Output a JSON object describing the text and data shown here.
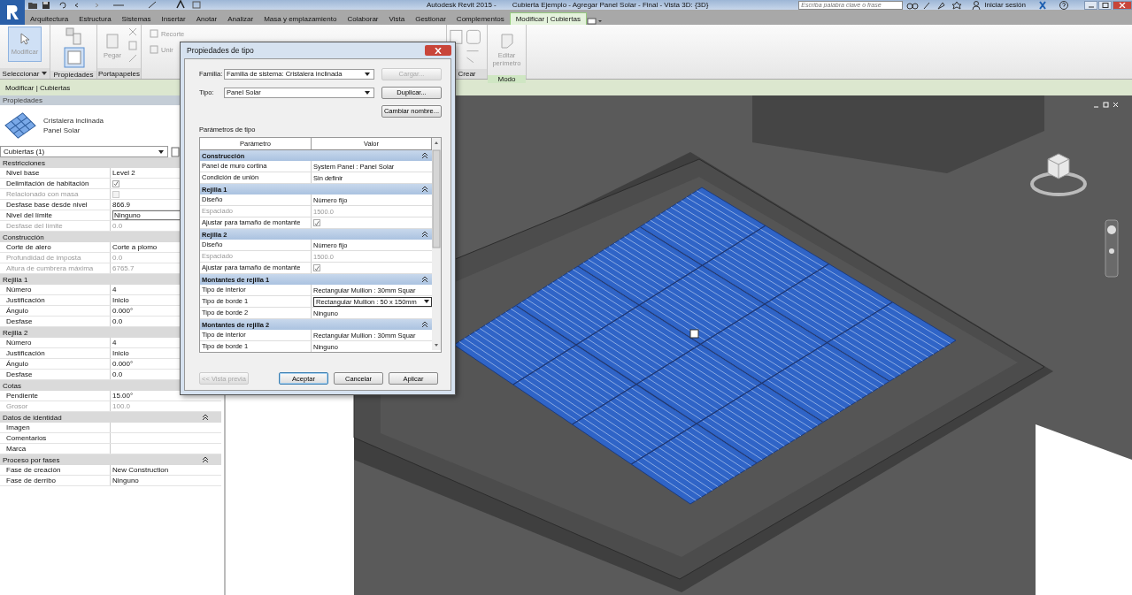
{
  "title_bar": {
    "app_title": "Autodesk Revit 2015 -",
    "document_title": "Cubierta Ejemplo - Agregar Panel Solar - Final - Vista 3D: {3D}",
    "search_placeholder": "Escriba palabra clave o frase",
    "sign_in": "Iniciar sesión"
  },
  "tabs": [
    {
      "label": "Arquitectura",
      "selected": false
    },
    {
      "label": "Estructura",
      "selected": false
    },
    {
      "label": "Sistemas",
      "selected": false
    },
    {
      "label": "Insertar",
      "selected": false
    },
    {
      "label": "Anotar",
      "selected": false
    },
    {
      "label": "Analizar",
      "selected": false
    },
    {
      "label": "Masa y emplazamiento",
      "selected": false
    },
    {
      "label": "Colaborar",
      "selected": false
    },
    {
      "label": "Vista",
      "selected": false
    },
    {
      "label": "Gestionar",
      "selected": false
    },
    {
      "label": "Complementos",
      "selected": false
    },
    {
      "label": "Modificar | Cubiertas",
      "selected": true
    }
  ],
  "ribbon_panels": [
    {
      "kind": "select",
      "label": "Seleccionar",
      "tools": [
        {
          "label": "Modificar",
          "selected": true
        }
      ]
    },
    {
      "kind": "properties",
      "label": "Propiedades"
    },
    {
      "kind": "clipboard",
      "label": "Portapapeles",
      "tools": [
        {
          "label": "Pegar",
          "selected": false
        }
      ]
    },
    {
      "kind": "geometry",
      "tools": [
        {
          "label": "Recorte",
          "selected": false
        },
        {
          "label": "Unir",
          "selected": false
        }
      ]
    },
    {
      "kind": "create",
      "label": "Crear"
    },
    {
      "kind": "mode",
      "label": "Modo",
      "tools": [
        {
          "label": "Editar perímetro",
          "selected": false
        }
      ]
    }
  ],
  "context_bar": "Modificar | Cubiertas",
  "properties": {
    "title": "Propiedades",
    "type_family": "Cristalera inclinada",
    "type_name": "Panel Solar",
    "filter": "Cubiertas (1)",
    "groups": [
      {
        "title": "Restricciones",
        "rows": [
          {
            "name": "Nivel base",
            "kind": "text",
            "value": "Level 2",
            "disabled": false
          },
          {
            "name": "Delimitación de habitación",
            "kind": "check",
            "checked": true,
            "disabled": false
          },
          {
            "name": "Relacionado con masa",
            "kind": "check",
            "checked": false,
            "disabled": true
          },
          {
            "name": "Desfase base desde nivel",
            "kind": "text",
            "value": "866.9",
            "disabled": false
          },
          {
            "name": "Nivel del límite",
            "kind": "field",
            "value": "Ninguno",
            "disabled": false
          },
          {
            "name": "Desfase del límite",
            "kind": "text",
            "value": "0.0",
            "disabled": true
          }
        ]
      },
      {
        "title": "Construcción",
        "rows": [
          {
            "name": "Corte de alero",
            "kind": "text",
            "value": "Corte a plomo",
            "disabled": false
          },
          {
            "name": "Profundidad de imposta",
            "kind": "text",
            "value": "0.0",
            "disabled": true
          },
          {
            "name": "Altura de cumbrera máxima",
            "kind": "text",
            "value": "6765.7",
            "disabled": true
          }
        ]
      },
      {
        "title": "Rejilla 1",
        "rows": [
          {
            "name": "Número",
            "kind": "text",
            "value": "4",
            "disabled": false
          },
          {
            "name": "Justificación",
            "kind": "text",
            "value": "Inicio",
            "disabled": false
          },
          {
            "name": "Ángulo",
            "kind": "text",
            "value": "0.000°",
            "disabled": false
          },
          {
            "name": "Desfase",
            "kind": "text",
            "value": "0.0",
            "disabled": false
          }
        ]
      },
      {
        "title": "Rejilla 2",
        "rows": [
          {
            "name": "Número",
            "kind": "text",
            "value": "4",
            "disabled": false
          },
          {
            "name": "Justificación",
            "kind": "text",
            "value": "Inicio",
            "disabled": false
          },
          {
            "name": "Ángulo",
            "kind": "text",
            "value": "0.000°",
            "disabled": false
          },
          {
            "name": "Desfase",
            "kind": "text",
            "value": "0.0",
            "disabled": false
          }
        ]
      },
      {
        "title": "Cotas",
        "rows": [
          {
            "name": "Pendiente",
            "kind": "text",
            "value": "15.00°",
            "disabled": false
          },
          {
            "name": "Grosor",
            "kind": "text",
            "value": "100.0",
            "disabled": true
          }
        ]
      },
      {
        "title": "Datos de identidad",
        "expanded": true,
        "rows": [
          {
            "name": "Imagen",
            "kind": "text",
            "disabled": false
          },
          {
            "name": "Comentarios",
            "kind": "text",
            "disabled": false
          },
          {
            "name": "Marca",
            "kind": "text",
            "disabled": false
          }
        ]
      },
      {
        "title": "Proceso por fases",
        "expanded": true,
        "rows": [
          {
            "name": "Fase de creación",
            "kind": "text",
            "value": "New Construction",
            "disabled": false
          },
          {
            "name": "Fase de derribo",
            "kind": "text",
            "value": "Ninguno",
            "disabled": false
          }
        ]
      }
    ]
  },
  "dialog": {
    "title": "Propiedades de tipo",
    "family_label": "Familia:",
    "family_value": "Familia de sistema: Cristalera inclinada",
    "type_label": "Tipo:",
    "type_value": "Panel Solar",
    "side_buttons": [
      {
        "label": "Cargar...",
        "disabled": true
      },
      {
        "label": "Duplicar...",
        "disabled": false
      },
      {
        "label": "Cambiar nombre...",
        "disabled": false
      }
    ],
    "params_label": "Parámetros de tipo",
    "columns": [
      "Parámetro",
      "Valor"
    ],
    "groups": [
      {
        "title": "Construcción",
        "rows": [
          {
            "name": "Panel de muro cortina",
            "kind": "text",
            "value": "System Panel : Panel Solar",
            "disabled": false
          },
          {
            "name": "Condición de unión",
            "kind": "text",
            "value": "Sin definir",
            "disabled": false
          }
        ]
      },
      {
        "title": "Rejilla 1",
        "rows": [
          {
            "name": "Diseño",
            "kind": "text",
            "value": "Número fijo",
            "disabled": false
          },
          {
            "name": "Espaciado",
            "kind": "text",
            "value": "1500.0",
            "disabled": true
          },
          {
            "name": "Ajustar para tamaño de montante",
            "kind": "check",
            "checked": true,
            "disabled": false
          }
        ]
      },
      {
        "title": "Rejilla 2",
        "rows": [
          {
            "name": "Diseño",
            "kind": "text",
            "value": "Número fijo",
            "disabled": false
          },
          {
            "name": "Espaciado",
            "kind": "text",
            "value": "1500.0",
            "disabled": true
          },
          {
            "name": "Ajustar para tamaño de montante",
            "kind": "check",
            "checked": true,
            "disabled": false
          }
        ]
      },
      {
        "title": "Montantes de rejilla 1",
        "rows": [
          {
            "name": "Tipo de interior",
            "kind": "text",
            "value": "Rectangular Mullion : 30mm Squar",
            "disabled": false
          },
          {
            "name": "Tipo de borde 1",
            "kind": "dropdown",
            "value": "Rectangular Mullion : 50 x 150mm",
            "disabled": false
          },
          {
            "name": "Tipo de borde 2",
            "kind": "text",
            "value": "Ninguno",
            "disabled": false
          }
        ]
      },
      {
        "title": "Montantes de rejilla 2",
        "rows": [
          {
            "name": "Tipo de interior",
            "kind": "text",
            "value": "Rectangular Mullion : 30mm Squar",
            "disabled": false
          },
          {
            "name": "Tipo de borde 1",
            "kind": "text",
            "value": "Ninguno",
            "disabled": false
          }
        ]
      }
    ],
    "buttons": [
      {
        "label": "<< Vista previa",
        "disabled": true,
        "default": false
      },
      {
        "label": "Aceptar",
        "disabled": false,
        "default": true
      },
      {
        "label": "Cancelar",
        "disabled": false,
        "default": false
      },
      {
        "label": "Aplicar",
        "disabled": false,
        "default": false
      }
    ]
  }
}
